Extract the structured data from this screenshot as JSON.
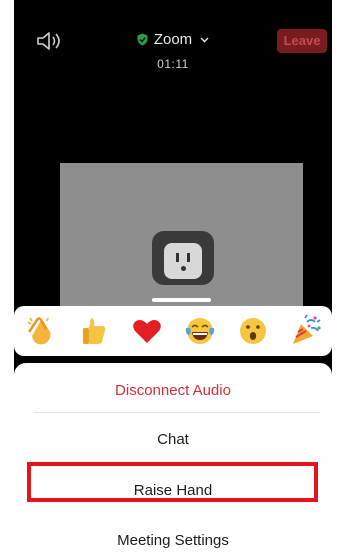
{
  "header": {
    "title": "Zoom",
    "time": "01:11",
    "leave_label": "Leave"
  },
  "icons": {
    "speaker": "speaker-icon",
    "shield": "shield-check-icon",
    "chevron": "chevron-down-icon"
  },
  "reactions": [
    {
      "name": "clap",
      "icon": "clapping-hands-emoji"
    },
    {
      "name": "thumbs-up",
      "icon": "thumbs-up-emoji"
    },
    {
      "name": "heart",
      "icon": "red-heart-emoji"
    },
    {
      "name": "joy",
      "icon": "tears-of-joy-emoji"
    },
    {
      "name": "open-mouth",
      "icon": "surprised-face-emoji"
    },
    {
      "name": "tada",
      "icon": "party-popper-emoji"
    }
  ],
  "menu": {
    "items": [
      {
        "label": "Disconnect Audio"
      },
      {
        "label": "Chat"
      },
      {
        "label": "Raise Hand"
      },
      {
        "label": "Meeting Settings"
      }
    ]
  },
  "colors": {
    "leave_bg": "#7a1b1f",
    "danger_text": "#d32f3a",
    "highlight_border": "#e8121c",
    "shield_green": "#2e9b4a"
  }
}
